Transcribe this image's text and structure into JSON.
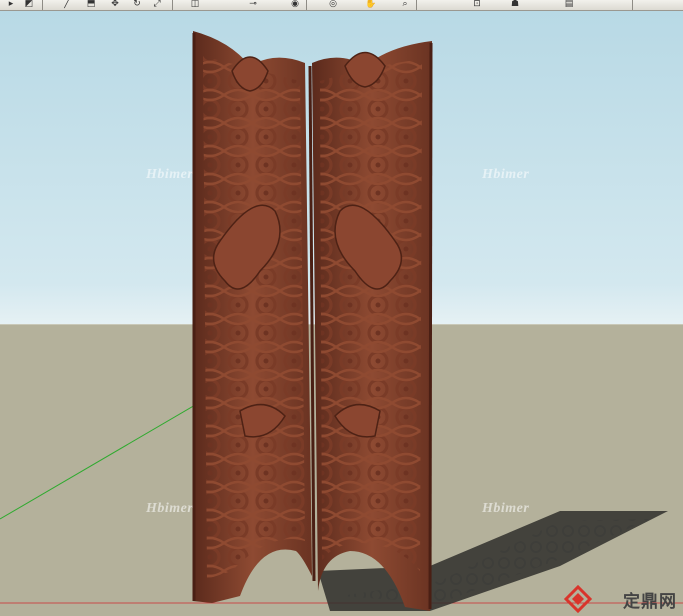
{
  "toolbar": {
    "buttons": [
      {
        "icon": "select-arrow-icon",
        "glyph": "▸"
      },
      {
        "icon": "eraser-icon",
        "glyph": "◩"
      },
      {
        "icon": "line-icon",
        "glyph": "╱"
      },
      {
        "icon": "push-pull-icon",
        "glyph": "⬒"
      },
      {
        "icon": "move-icon",
        "glyph": "✥"
      },
      {
        "icon": "rotate-icon",
        "glyph": "↻"
      },
      {
        "icon": "scale-icon",
        "glyph": "⤢"
      },
      {
        "icon": "offset-icon",
        "glyph": "◫"
      },
      {
        "icon": "tape-measure-icon",
        "glyph": "⊸"
      },
      {
        "icon": "paint-bucket-icon",
        "glyph": "◉"
      },
      {
        "icon": "orbit-icon",
        "glyph": "◎"
      },
      {
        "icon": "pan-icon",
        "glyph": "✋"
      },
      {
        "icon": "zoom-icon",
        "glyph": "⌕"
      },
      {
        "icon": "zoom-extents-icon",
        "glyph": "⊡"
      },
      {
        "icon": "walk-icon",
        "glyph": "☗"
      },
      {
        "icon": "section-icon",
        "glyph": "▤"
      }
    ]
  },
  "viewport": {
    "watermarks": [
      "Hbimer",
      "Hbimer",
      "Hbimer",
      "Hbimer"
    ]
  },
  "brand": {
    "text": "定鼎网",
    "color": "#d9342b"
  }
}
